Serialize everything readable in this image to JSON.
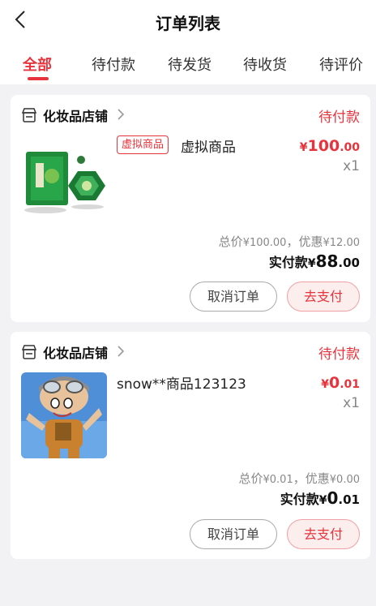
{
  "header": {
    "title": "订单列表"
  },
  "tabs": [
    {
      "label": "全部",
      "active": true
    },
    {
      "label": "待付款",
      "active": false
    },
    {
      "label": "待发货",
      "active": false
    },
    {
      "label": "待收货",
      "active": false
    },
    {
      "label": "待评价",
      "active": false
    }
  ],
  "orders": [
    {
      "store": "化妆品店铺",
      "status": "待付款",
      "tag": "虚拟商品",
      "product_name": "虚拟商品",
      "price": {
        "symbol": "¥",
        "int": "100",
        "dec": ".00"
      },
      "quantity": "x1",
      "summary": {
        "total_label": "总价",
        "total": "100.00",
        "sep": "，",
        "discount_label": "优惠",
        "discount": "12.00"
      },
      "paid": {
        "label": "实付款",
        "symbol": "¥",
        "int": "88",
        "dec": ".00"
      },
      "buttons": {
        "cancel": "取消订单",
        "pay": "去支付"
      },
      "thumb_icon": "green-gift-box-image"
    },
    {
      "store": "化妆品店铺",
      "status": "待付款",
      "product_name": "snow**商品123123",
      "price": {
        "symbol": "¥",
        "int": "0",
        "dec": ".01"
      },
      "quantity": "x1",
      "summary": {
        "total_label": "总价",
        "total": "0.01",
        "sep": "，",
        "discount_label": "优惠",
        "discount": "0.00"
      },
      "paid": {
        "label": "实付款",
        "symbol": "¥",
        "int": "0",
        "dec": ".01"
      },
      "buttons": {
        "cancel": "取消订单",
        "pay": "去支付"
      },
      "thumb_icon": "cartoon-boy-pilot-image"
    }
  ],
  "currency": "¥",
  "colors": {
    "accent": "#e7333c",
    "background": "#f2f2f4"
  }
}
